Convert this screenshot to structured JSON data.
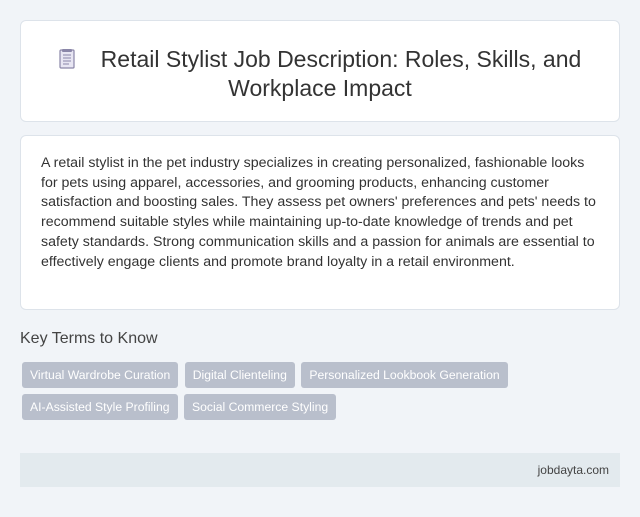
{
  "header": {
    "icon": "document-icon",
    "title": "Retail Stylist Job Description: Roles, Skills, and Workplace Impact"
  },
  "description": {
    "text": "A retail stylist in the pet industry specializes in creating personalized, fashionable looks for pets using apparel, accessories, and grooming products, enhancing customer satisfaction and boosting sales. They assess pet owners' preferences and pets' needs to recommend suitable styles while maintaining up-to-date knowledge of trends and pet safety standards. Strong communication skills and a passion for animals are essential to effectively engage clients and promote brand loyalty in a retail environment."
  },
  "key_terms": {
    "heading": "Key Terms to Know",
    "tags": [
      "Virtual Wardrobe Curation",
      "Digital Clienteling",
      "Personalized Lookbook Generation",
      "AI-Assisted Style Profiling",
      "Social Commerce Styling"
    ]
  },
  "footer": {
    "site": "jobdayta.com"
  },
  "colors": {
    "background": "#f1f4f8",
    "card": "#ffffff",
    "tag": "#b9bfcc",
    "footer": "#e3eaee"
  }
}
